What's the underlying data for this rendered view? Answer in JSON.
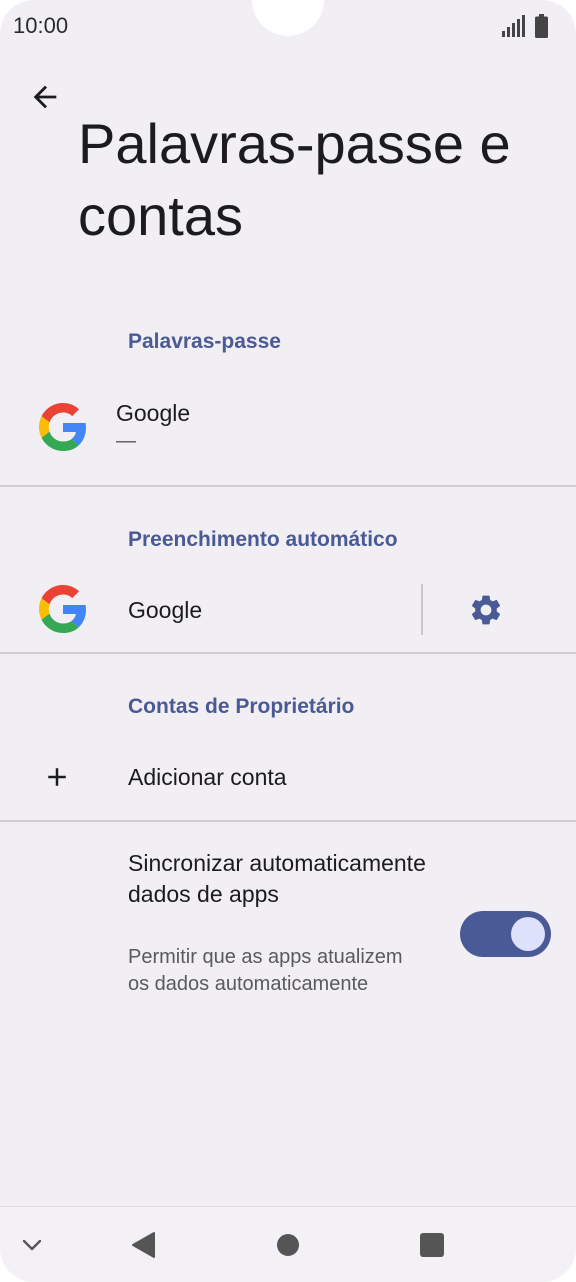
{
  "status_bar": {
    "time": "10:00"
  },
  "page": {
    "title": "Palavras-passe e contas"
  },
  "passwords": {
    "header": "Palavras-passe",
    "provider_name": "Google",
    "provider_sub": "—"
  },
  "autofill": {
    "header": "Preenchimento automático",
    "provider_name": "Google"
  },
  "accounts": {
    "header": "Contas de Proprietário",
    "add_account_label": "Adicionar conta"
  },
  "sync": {
    "title": "Sincronizar automaticamente dados de apps",
    "subtitle": "Permitir que as apps atualizem os dados automaticamente",
    "enabled": true
  },
  "colors": {
    "accent": "#4a5a96",
    "background": "#f1eff3",
    "toggle_knob": "#dde1fb"
  }
}
